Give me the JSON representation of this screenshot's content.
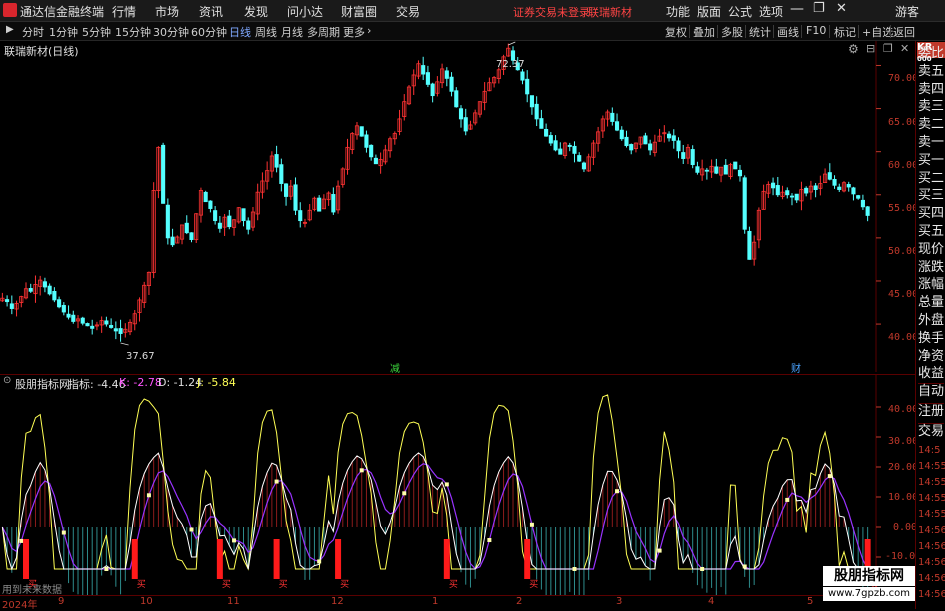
{
  "app": {
    "title": "通达信金融终端"
  },
  "menu": [
    {
      "label": "行情"
    },
    {
      "label": "市场"
    },
    {
      "label": "资讯"
    },
    {
      "label": "发现"
    },
    {
      "label": "问小达"
    },
    {
      "label": "财富圈"
    },
    {
      "label": "交易"
    }
  ],
  "notice": {
    "text": "证券交易未登录",
    "stock": "联瑞新材"
  },
  "top_right": [
    {
      "label": "功能"
    },
    {
      "label": "版面"
    },
    {
      "label": "公式"
    },
    {
      "label": "选项"
    },
    {
      "label": "游客"
    }
  ],
  "timeframes": [
    {
      "label": "分时"
    },
    {
      "label": "1分钟"
    },
    {
      "label": "5分钟"
    },
    {
      "label": "15分钟"
    },
    {
      "label": "30分钟"
    },
    {
      "label": "60分钟"
    },
    {
      "label": "日线"
    },
    {
      "label": "周线"
    },
    {
      "label": "月线"
    },
    {
      "label": "多周期"
    },
    {
      "label": "更多"
    }
  ],
  "toolbar_right": [
    {
      "label": "复权"
    },
    {
      "label": "叠加"
    },
    {
      "label": "多股"
    },
    {
      "label": "统计"
    },
    {
      "label": "画线"
    },
    {
      "label": "F10"
    },
    {
      "label": "标记"
    },
    {
      "label": "+自选"
    },
    {
      "label": "返回"
    }
  ],
  "chart_title": "联瑞新材(日线)",
  "indicator": {
    "name": "股朋指标网",
    "label": "指标: -4.46",
    "k": "K: -2.78",
    "d": "D: -1.24",
    "j": "J: -5.84"
  },
  "markers": {
    "high": "72.37",
    "low": "37.67",
    "jian": "减",
    "cai": "财",
    "mai": "买"
  },
  "price_axis": [
    "70.00",
    "65.00",
    "60.00",
    "55.00",
    "50.00",
    "45.00",
    "40.00"
  ],
  "ind_axis": [
    "40.00",
    "30.00",
    "20.00",
    "10.00",
    "0.00",
    "-10.00"
  ],
  "right_panel": {
    "logo": "KR",
    "logo_sub": "000",
    "items": [
      "委比",
      "卖五",
      "卖四",
      "卖三",
      "卖二",
      "卖一",
      "买一",
      "买二",
      "买三",
      "买四",
      "买五",
      "现价",
      "涨跌",
      "涨幅",
      "总量",
      "外盘",
      "换手",
      "净资",
      "收益",
      "自动",
      "注册",
      "交易"
    ],
    "times": [
      "14:5",
      "14:55",
      "14:55",
      "14:55",
      "14:55",
      "14:56",
      "14:56",
      "14:56",
      "14:56",
      "14:56"
    ]
  },
  "months": [
    {
      "label": "2024年"
    },
    {
      "label": "9"
    },
    {
      "label": "10"
    },
    {
      "label": "11"
    },
    {
      "label": "12"
    },
    {
      "label": "1"
    },
    {
      "label": "2"
    },
    {
      "label": "3"
    },
    {
      "label": "4"
    },
    {
      "label": "5"
    }
  ],
  "future_data_note": "用到未来数据",
  "watermark": {
    "title": "股朋指标网",
    "url": "www.7gpzb.com"
  },
  "colors": {
    "up": "#ff3333",
    "down": "#54ffff",
    "kline": "#ffffff",
    "dline": "#ffff55",
    "jline": "#ff55ff",
    "axis": "#c0392b"
  },
  "chart_data": {
    "type": "candlestick",
    "y_range": [
      38,
      73
    ],
    "closes": [
      43.0,
      42.6,
      41.8,
      42.4,
      43.2,
      44.1,
      43.8,
      44.6,
      45.1,
      44.3,
      43.5,
      42.8,
      42.0,
      41.4,
      40.8,
      40.3,
      40.6,
      40.1,
      39.8,
      39.5,
      39.9,
      40.4,
      40.0,
      39.6,
      39.2,
      38.9,
      39.4,
      40.2,
      41.2,
      42.8,
      44.5,
      46.0,
      55.5,
      60.5,
      54.0,
      50.0,
      49.2,
      50.1,
      51.5,
      50.6,
      49.8,
      52.8,
      55.5,
      54.2,
      53.4,
      52.0,
      51.1,
      52.4,
      51.3,
      52.1,
      53.5,
      52.0,
      51.0,
      53.0,
      55.3,
      56.6,
      57.8,
      59.5,
      58.2,
      56.3,
      54.8,
      56.0,
      53.2,
      52.0,
      51.8,
      53.2,
      54.6,
      53.1,
      54.5,
      55.2,
      53.0,
      56.0,
      58.0,
      60.5,
      62.1,
      63.0,
      61.8,
      60.5,
      59.4,
      58.6,
      59.1,
      60.2,
      61.5,
      62.1,
      63.8,
      65.8,
      67.5,
      68.9,
      70.2,
      69.0,
      67.8,
      66.5,
      68.1,
      69.6,
      68.5,
      67.0,
      65.2,
      63.8,
      62.4,
      63.1,
      64.5,
      65.8,
      67.0,
      68.0,
      68.6,
      69.5,
      71.0,
      72.0,
      70.6,
      69.5,
      68.3,
      66.7,
      65.2,
      63.8,
      62.7,
      61.8,
      61.0,
      60.2,
      59.7,
      61.0,
      60.6,
      59.8,
      58.9,
      58.0,
      59.4,
      61.0,
      62.3,
      63.8,
      64.6,
      63.5,
      62.5,
      61.5,
      60.7,
      60.2,
      61.0,
      61.7,
      60.9,
      60.2,
      61.1,
      61.8,
      62.2,
      61.6,
      61.3,
      60.1,
      59.2,
      60.5,
      58.5,
      57.6,
      58.0,
      57.8,
      58.3,
      57.5,
      58.2,
      57.4,
      58.5,
      58.0,
      57.2,
      51.0,
      47.5,
      49.5,
      53.2,
      55.4,
      56.2,
      55.8,
      55.0,
      55.3,
      55.0,
      54.8,
      54.4,
      55.6,
      55.2,
      56.0,
      55.6,
      56.3,
      57.4,
      56.8,
      56.1,
      55.6,
      56.4,
      55.9,
      55.1,
      54.6,
      53.6,
      52.6
    ]
  }
}
